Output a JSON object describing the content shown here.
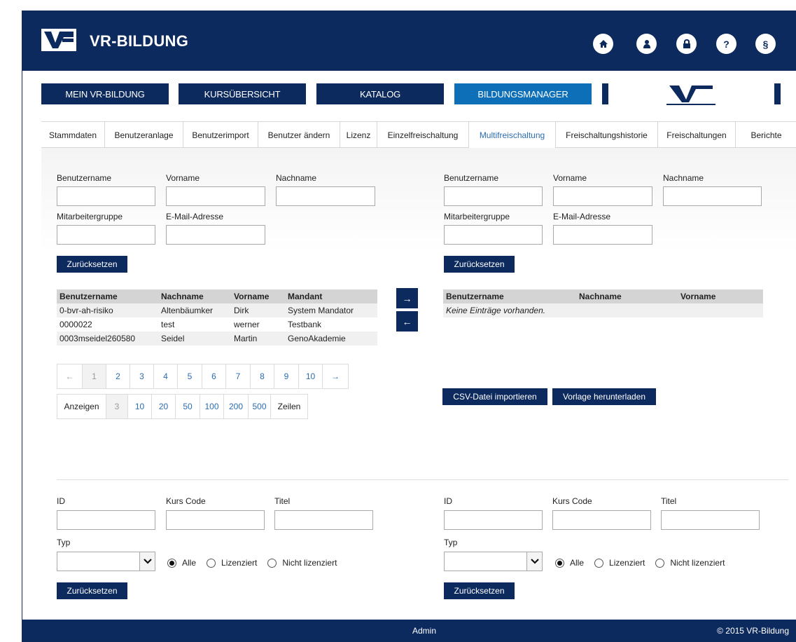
{
  "header": {
    "brand": "VR-BILDUNG",
    "icons": [
      "home-icon",
      "user-icon",
      "lock-icon",
      "help-icon",
      "paragraph-icon"
    ],
    "icon_glyphs": [
      "",
      "",
      "",
      "?",
      "§"
    ]
  },
  "mainnav": [
    "MEIN VR-BILDUNG",
    "KURSÜBERSICHT",
    "KATALOG",
    "BILDUNGSMANAGER"
  ],
  "tabs": [
    "Stammdaten",
    "Benutzeranlage",
    "Benutzerimport",
    "Benutzer ändern",
    "Lizenz",
    "Einzelfreischaltung",
    "Multifreischaltung",
    "Freischaltungshistorie",
    "Freischaltungen",
    "Berichte"
  ],
  "active_tab": "Multifreischaltung",
  "user_filter_left": {
    "username_label": "Benutzername",
    "firstname_label": "Vorname",
    "lastname_label": "Nachname",
    "group_label": "Mitarbeitergruppe",
    "email_label": "E-Mail-Adresse",
    "reset_label": "Zurücksetzen"
  },
  "user_filter_right": {
    "username_label": "Benutzername",
    "firstname_label": "Vorname",
    "lastname_label": "Nachname",
    "group_label": "Mitarbeitergruppe",
    "email_label": "E-Mail-Adresse",
    "reset_label": "Zurücksetzen"
  },
  "user_table_left": {
    "headers": [
      "Benutzername",
      "Nachname",
      "Vorname",
      "Mandant"
    ],
    "rows": [
      [
        "0-bvr-ah-risiko",
        "Altenbäumker",
        "Dirk",
        "System Mandator"
      ],
      [
        "0000022",
        "test",
        "werner",
        "Testbank"
      ],
      [
        "0003mseidel260580",
        "Seidel",
        "Martin",
        "GenoAkademie"
      ]
    ]
  },
  "transfer": {
    "right_arrow": "→",
    "left_arrow": "←"
  },
  "user_table_right": {
    "headers": [
      "Benutzername",
      "Nachname",
      "Vorname"
    ],
    "empty_text": "Keine Einträge vorhanden."
  },
  "pagination": {
    "prev": "←",
    "pages": [
      "1",
      "2",
      "3",
      "4",
      "5",
      "6",
      "7",
      "8",
      "9",
      "10"
    ],
    "current": "1",
    "next": "→"
  },
  "rows_per_page": {
    "label": "Anzeigen",
    "options": [
      "3",
      "10",
      "20",
      "50",
      "100",
      "200",
      "500"
    ],
    "selected": "3",
    "suffix": "Zeilen"
  },
  "import": {
    "csv_label": "CSV-Datei importieren",
    "template_label": "Vorlage herunterladen"
  },
  "course_filter_left": {
    "id_label": "ID",
    "code_label": "Kurs Code",
    "title_label": "Titel",
    "type_label": "Typ",
    "radio_all": "Alle",
    "radio_licensed": "Lizenziert",
    "radio_unlicensed": "Nicht lizenziert",
    "selected_radio": "Alle",
    "reset_label": "Zurücksetzen"
  },
  "course_filter_right": {
    "id_label": "ID",
    "code_label": "Kurs Code",
    "title_label": "Titel",
    "type_label": "Typ",
    "radio_all": "Alle",
    "radio_licensed": "Lizenziert",
    "radio_unlicensed": "Nicht lizenziert",
    "selected_radio": "Alle",
    "reset_label": "Zurücksetzen"
  },
  "footer": {
    "user": "Admin",
    "copyright": "© 2015 VR-Bildung"
  },
  "colors": {
    "navy": "#0d2a5e",
    "active_blue": "#0d6fb8",
    "link_blue": "#2b6cb0"
  }
}
